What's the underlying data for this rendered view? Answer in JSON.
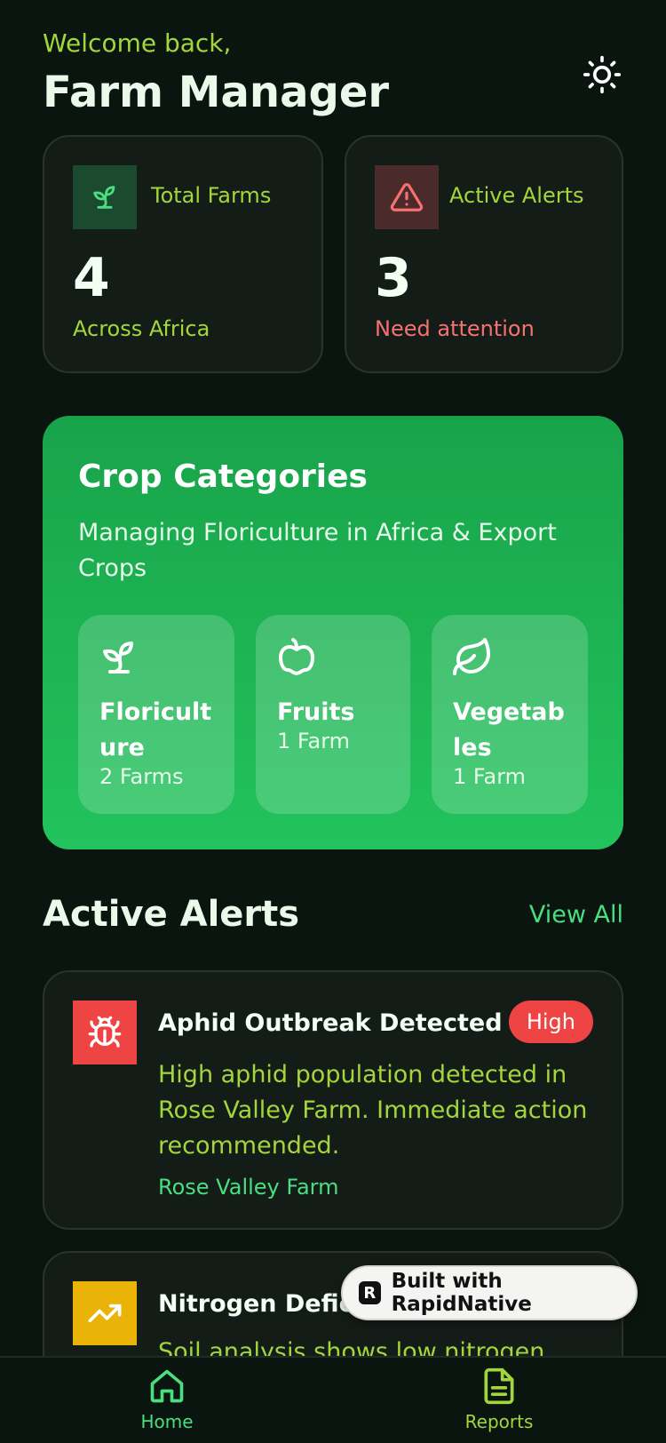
{
  "header": {
    "welcome": "Welcome back,",
    "title": "Farm Manager",
    "theme_icon": "sun-icon"
  },
  "stats": [
    {
      "label": "Total Farms",
      "value": "4",
      "sub": "Across Africa",
      "icon": "sprout-icon",
      "sub_color": "#a3d63c"
    },
    {
      "label": "Active Alerts",
      "value": "3",
      "sub": "Need attention",
      "icon": "warning-icon",
      "sub_color": "#f87171"
    }
  ],
  "crops": {
    "title": "Crop Categories",
    "subtitle": "Managing Floriculture in Africa & Export Crops",
    "tiles": [
      {
        "name": "Floriculture",
        "count": "2 Farms",
        "icon": "sprout-icon"
      },
      {
        "name": "Fruits",
        "count": "1 Farm",
        "icon": "apple-icon"
      },
      {
        "name": "Vegetables",
        "count": "1 Farm",
        "icon": "leaf-icon"
      }
    ]
  },
  "alerts_section": {
    "title": "Active Alerts",
    "view_all": "View All",
    "items": [
      {
        "title": "Aphid Outbreak Detected",
        "badge": "High",
        "description": "High aphid population detected in Rose Valley Farm. Immediate action recommended.",
        "farm": "Rose Valley Farm",
        "icon": "bug-icon",
        "icon_color": "#ef4444"
      },
      {
        "title": "Nitrogen Defici",
        "description": "Soil analysis shows low nitrogen",
        "icon": "trending-up-icon",
        "icon_color": "#eab308"
      }
    ]
  },
  "nav": {
    "home": "Home",
    "reports": "Reports"
  },
  "badge": {
    "text": "Built with RapidNative",
    "logo": "R"
  },
  "colors": {
    "background": "#0b1510",
    "accent_green": "#4ade80",
    "lime": "#a3d63c",
    "danger": "#ef4444",
    "warning": "#eab308"
  }
}
